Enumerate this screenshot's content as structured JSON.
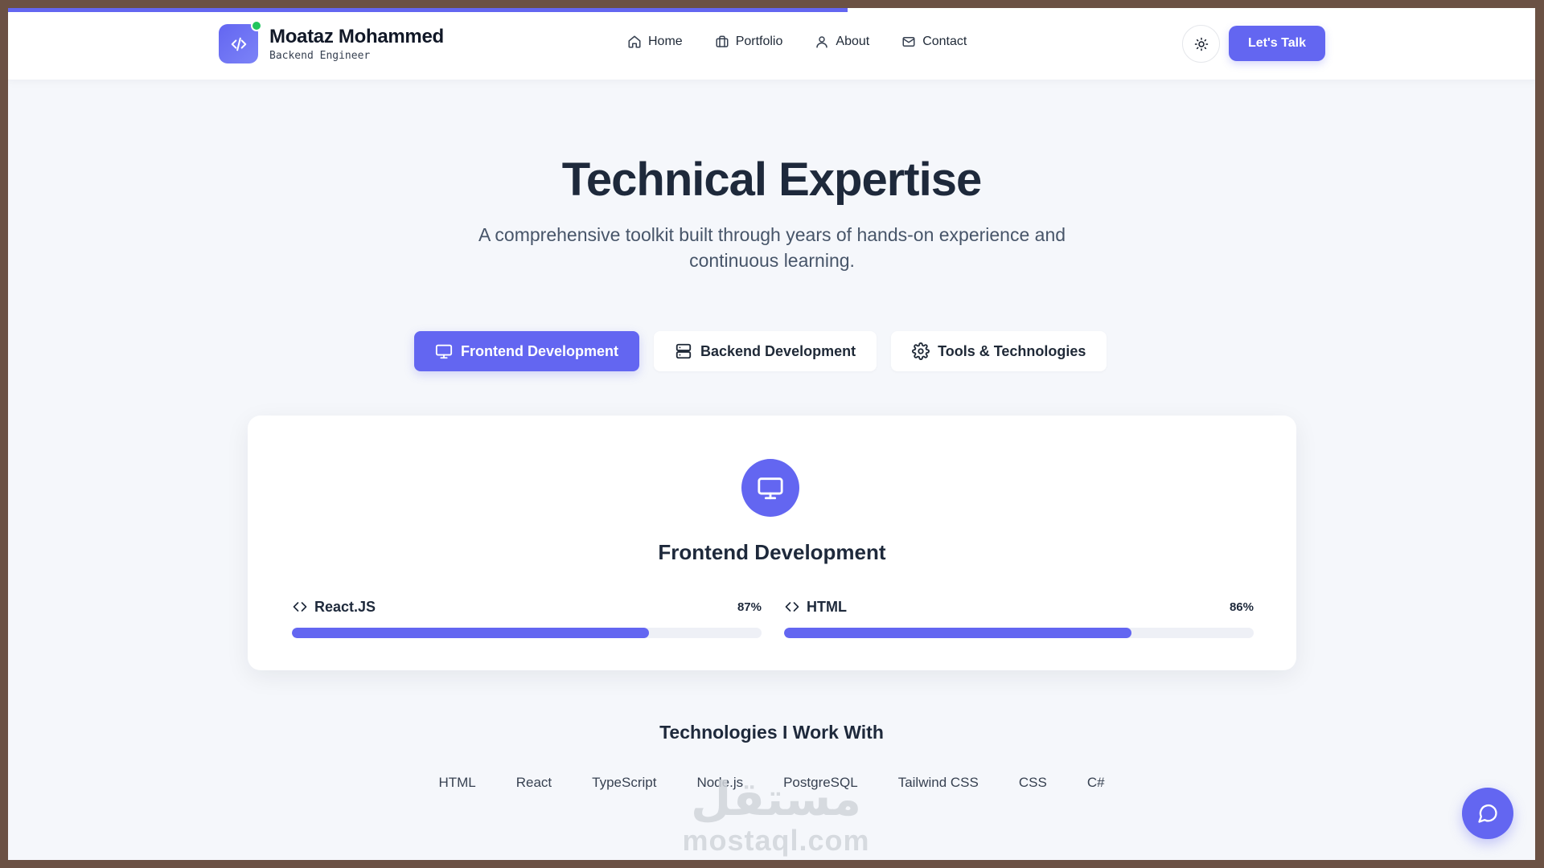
{
  "brand": {
    "name": "Moataz Mohammed",
    "role": "Backend Engineer",
    "logo_icon": "code-icon",
    "status_color": "#22c55e"
  },
  "nav": {
    "items": [
      {
        "label": "Home",
        "icon": "home-icon"
      },
      {
        "label": "Portfolio",
        "icon": "briefcase-icon"
      },
      {
        "label": "About",
        "icon": "user-icon"
      },
      {
        "label": "Contact",
        "icon": "mail-icon"
      }
    ],
    "theme_toggle_icon": "sun-icon",
    "cta_label": "Let's Talk"
  },
  "hero": {
    "title": "Technical Expertise",
    "subtitle": "A comprehensive toolkit built through years of hands-on experience and continuous learning."
  },
  "tabs": [
    {
      "label": "Frontend Development",
      "icon": "monitor-icon",
      "active": true
    },
    {
      "label": "Backend Development",
      "icon": "server-icon",
      "active": false
    },
    {
      "label": "Tools & Technologies",
      "icon": "gear-icon",
      "active": false
    }
  ],
  "card": {
    "icon": "monitor-icon",
    "title": "Frontend Development",
    "skills": [
      {
        "name": "React.JS",
        "percent_label": "87%",
        "bar_fraction": 0.76,
        "icon": "code-icon"
      },
      {
        "name": "HTML",
        "percent_label": "86%",
        "bar_fraction": 0.74,
        "icon": "code-icon"
      }
    ]
  },
  "technologies": {
    "title": "Technologies I Work With",
    "items": [
      "HTML",
      "React",
      "TypeScript",
      "Node.js",
      "PostgreSQL",
      "Tailwind CSS",
      "CSS",
      "C#"
    ]
  },
  "watermark": {
    "glyph": "مستقل",
    "text": "mostaql.com"
  },
  "page_progress_fraction": 0.55,
  "colors": {
    "accent": "#6366f1",
    "heading": "#1e293b",
    "background": "#f5f7fb"
  }
}
